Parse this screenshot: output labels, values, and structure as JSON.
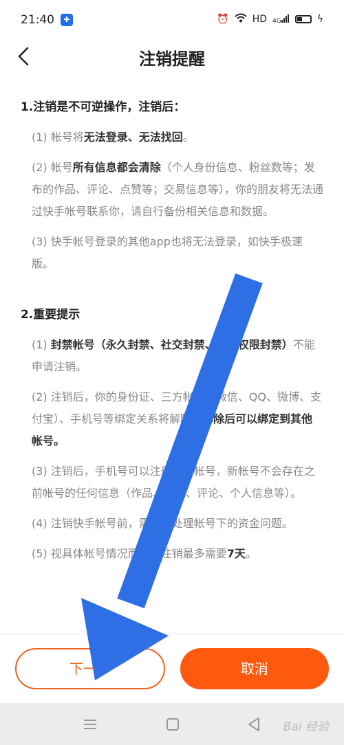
{
  "status_bar": {
    "time": "21:40",
    "network": "HD",
    "signal": "4G"
  },
  "header": {
    "title": "注销提醒"
  },
  "section1": {
    "title": "1.注销是不可逆操作，注销后：",
    "items": [
      {
        "prefix": "(1) 帐号将",
        "bold": "无法登录、无法找回",
        "suffix": "。"
      },
      {
        "prefix": "(2) 帐号",
        "bold": "所有信息都会清除",
        "suffix": "（个人身份信息、粉丝数等；发布的作品、评论、点赞等；交易信息等），你的朋友将无法通过快手帐号联系你，请自行备份相关信息和数据。"
      },
      {
        "prefix": "(3) 快手帐号登录的其他app也将无法登录，如快手极速版。",
        "bold": "",
        "suffix": ""
      }
    ]
  },
  "section2": {
    "title": "2.重要提示",
    "items": [
      {
        "prefix": "(1) ",
        "bold": "封禁帐号（永久封禁、社交封禁、直播权限封禁）",
        "suffix": "不能申请注销。"
      },
      {
        "prefix": "(2) 注销后，你的身份证、三方帐号（微信、QQ、微博、支付宝）、手机号等绑定关系将解除，",
        "bold": "解除后可以绑定到其他帐号。",
        "suffix": ""
      },
      {
        "prefix": "(3) 注销后，手机号可以注册新的帐号，新帐号不会存在之前帐号的任何信息（作品、粉丝、评论、个人信息等）。",
        "bold": "",
        "suffix": ""
      },
      {
        "prefix": "(4) 注销快手帐号前，需尽快处理帐号下的资金问题。",
        "bold": "",
        "suffix": ""
      },
      {
        "prefix": "(5) 视具体帐号情况而定，注销最多需要",
        "bold": "7天",
        "suffix": "。"
      }
    ]
  },
  "footer": {
    "next_label": "下一步",
    "cancel_label": "取消"
  },
  "navbar": {
    "watermark": "Bai 经验"
  },
  "colors": {
    "accent": "#fe5a0f",
    "arrow": "#2f6fe6"
  }
}
